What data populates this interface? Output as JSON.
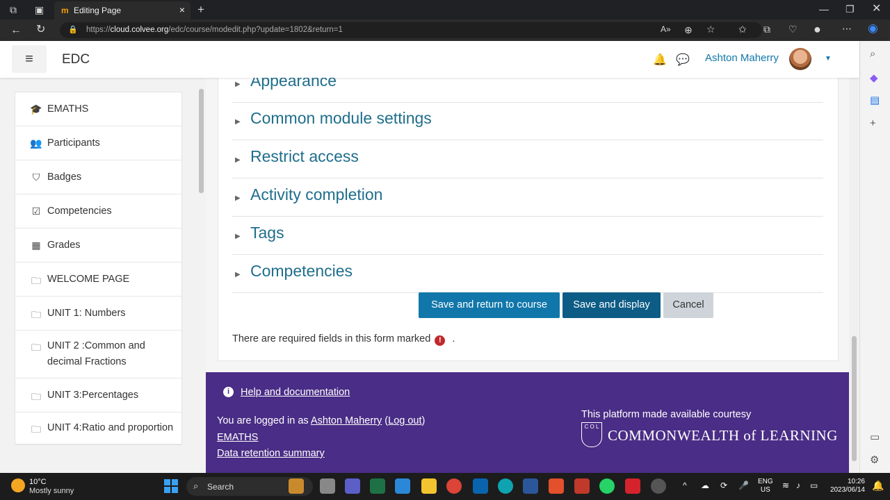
{
  "browser": {
    "tab_title": "Editing Page",
    "url_prefix": "https://",
    "url_host": "cloud.colvee.org",
    "url_path": "/edc/course/modedit.php?update=1802&return=1"
  },
  "header": {
    "site_name": "EDC",
    "user_name": "Ashton Maherry"
  },
  "nav": {
    "items": [
      {
        "label": "EMATHS",
        "icon": "graduation-cap-icon"
      },
      {
        "label": "Participants",
        "icon": "users-icon"
      },
      {
        "label": "Badges",
        "icon": "shield-icon"
      },
      {
        "label": "Competencies",
        "icon": "checkbox-icon"
      },
      {
        "label": "Grades",
        "icon": "table-icon"
      },
      {
        "label": "WELCOME PAGE",
        "icon": "folder-icon"
      },
      {
        "label": "UNIT 1: Numbers",
        "icon": "folder-icon"
      },
      {
        "label": "UNIT 2 :Common and decimal Fractions",
        "icon": "folder-icon"
      },
      {
        "label": "UNIT 3:Percentages",
        "icon": "folder-icon"
      },
      {
        "label": "UNIT 4:Ratio and proportion",
        "icon": "folder-icon"
      }
    ]
  },
  "form": {
    "sections": [
      "Appearance",
      "Common module settings",
      "Restrict access",
      "Activity completion",
      "Tags",
      "Competencies"
    ],
    "save_return_label": "Save and return to course",
    "save_display_label": "Save and display",
    "cancel_label": "Cancel",
    "required_note": "There are required fields in this form marked",
    "required_icon": "!",
    "required_period": "."
  },
  "footer": {
    "help_label": "Help and documentation",
    "logged_in_prefix": "You are logged in as",
    "logged_in_user": "Ashton Maherry",
    "logout_label": "Log out",
    "course_link": "EMATHS",
    "retention_label": "Data retention summary",
    "courtesy_text": "This platform made available courtesy",
    "col_name": "COMMONWEALTH of LEARNING",
    "col_mark": "C O L"
  },
  "taskbar": {
    "temperature": "10°C",
    "condition": "Mostly sunny",
    "search_label": "Search",
    "lang_top": "ENG",
    "lang_bottom": "US",
    "time": "10:26",
    "date": "2023/06/14"
  }
}
